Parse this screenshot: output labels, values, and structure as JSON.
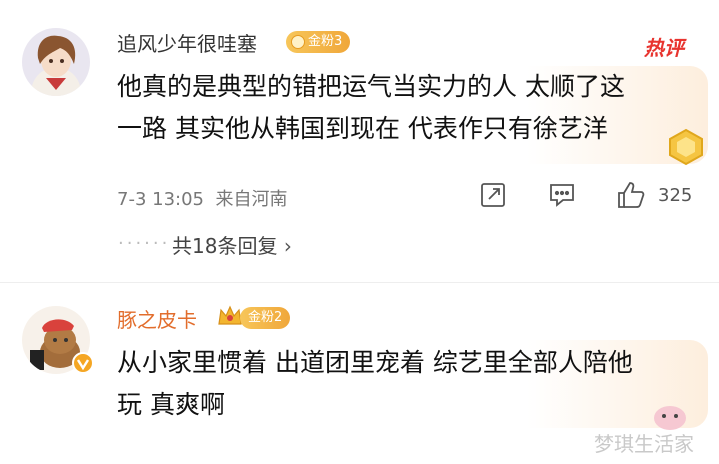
{
  "comments": [
    {
      "username": "追风少年很哇塞",
      "badge": "金粉3",
      "hot_tag": "热评",
      "text_line1": "他真的是典型的错把运气当实力的人 太顺了这",
      "text_line2": "一路 其实他从韩国到现在 代表作只有徐艺洋",
      "timestamp": "7-3 13:05",
      "location": "来自河南",
      "like_count": "325",
      "replies_label": "共18条回复"
    },
    {
      "username": "豚之皮卡",
      "badge": "金粉2",
      "text_line1": "从小家里惯着 出道团里宠着 综艺里全部人陪他",
      "text_line2": "玩 真爽啊"
    }
  ],
  "watermark": "梦琪生活家",
  "colors": {
    "badge": "#f0a73a",
    "hot": "#e8342f",
    "username2": "#e26d2c",
    "verified": "#f5a623"
  }
}
